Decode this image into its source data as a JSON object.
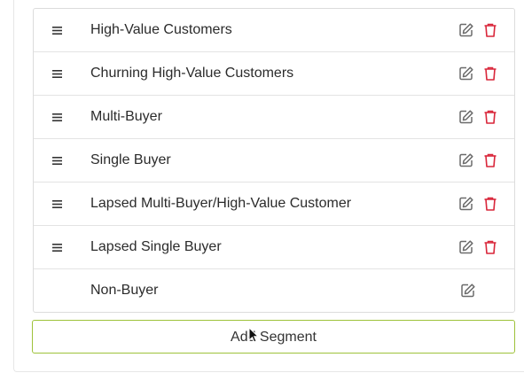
{
  "segments": [
    {
      "name": "High-Value Customers",
      "deletable": true
    },
    {
      "name": "Churning High-Value Customers",
      "deletable": true
    },
    {
      "name": "Multi-Buyer",
      "deletable": true
    },
    {
      "name": "Single Buyer",
      "deletable": true
    },
    {
      "name": "Lapsed Multi-Buyer/High-Value Customer",
      "deletable": true
    },
    {
      "name": "Lapsed Single Buyer",
      "deletable": true
    },
    {
      "name": "Non-Buyer",
      "deletable": false
    }
  ],
  "add_button_label": "Add Segment",
  "icons": {
    "drag": "drag-handle-icon",
    "edit": "edit-icon",
    "delete": "trash-icon"
  },
  "colors": {
    "edit_icon": "#6b6b6b",
    "delete_icon": "#d9263a",
    "add_button_border": "#9ec23a",
    "text": "#2b2b2b"
  }
}
